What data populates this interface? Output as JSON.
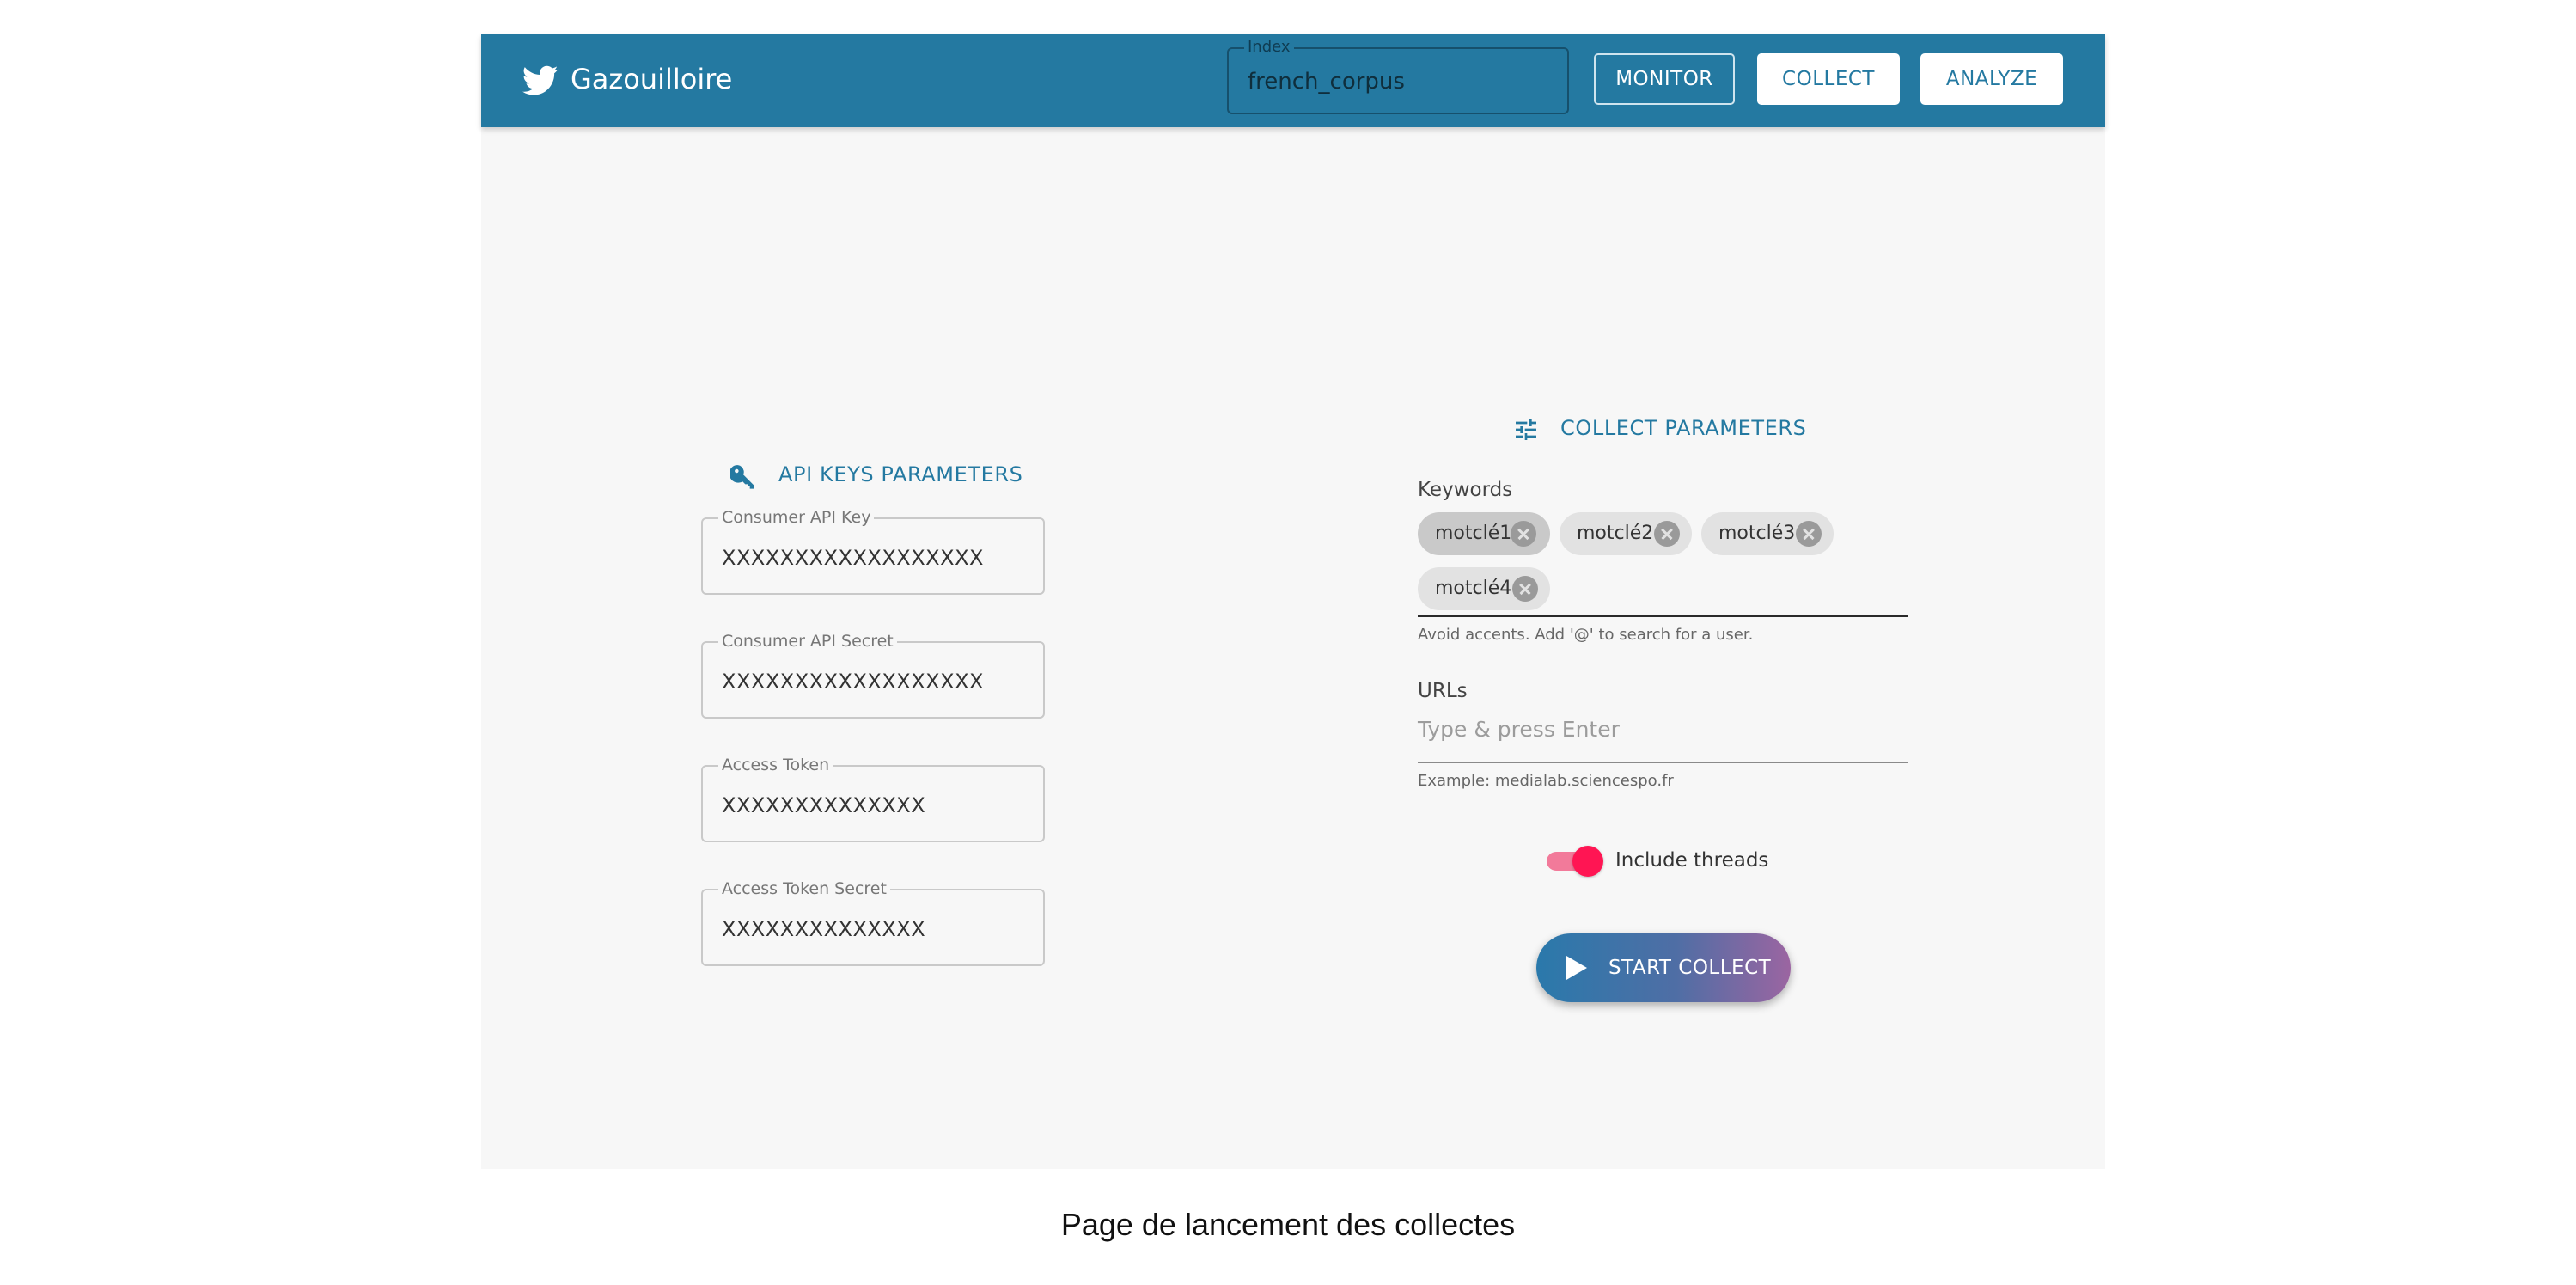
{
  "header": {
    "app_name": "Gazouilloire",
    "brand_icon": "twitter-bird-icon",
    "index": {
      "label": "Index",
      "value": "french_corpus"
    },
    "buttons": {
      "monitor": "MONITOR",
      "collect": "COLLECT",
      "analyze": "ANALYZE"
    }
  },
  "api_keys": {
    "title": "API KEYS PARAMETERS",
    "icon": "key-icon",
    "fields": [
      {
        "label": "Consumer API Key",
        "value": "XXXXXXXXXXXXXXXXXX"
      },
      {
        "label": "Consumer API Secret",
        "value": "XXXXXXXXXXXXXXXXXX"
      },
      {
        "label": "Access Token",
        "value": "XXXXXXXXXXXXXX"
      },
      {
        "label": "Access Token Secret",
        "value": "XXXXXXXXXXXXXX"
      }
    ]
  },
  "collect": {
    "title": "COLLECT PARAMETERS",
    "icon": "tune-sliders-icon",
    "keywords": {
      "label": "Keywords",
      "chips": [
        "motclé1",
        "motclé2",
        "motclé3",
        "motclé4"
      ],
      "helper": "Avoid accents. Add '@' to search for a user."
    },
    "urls": {
      "label": "URLs",
      "placeholder": "Type & press Enter",
      "helper": "Example: medialab.sciencespo.fr"
    },
    "include_threads": {
      "label": "Include threads",
      "enabled": true
    },
    "start_button": "START COLLECT"
  },
  "caption": "Page de lancement des collectes",
  "colors": {
    "primary": "#2479a1",
    "toggle": "#ff1553",
    "background": "#f7f7f7"
  }
}
